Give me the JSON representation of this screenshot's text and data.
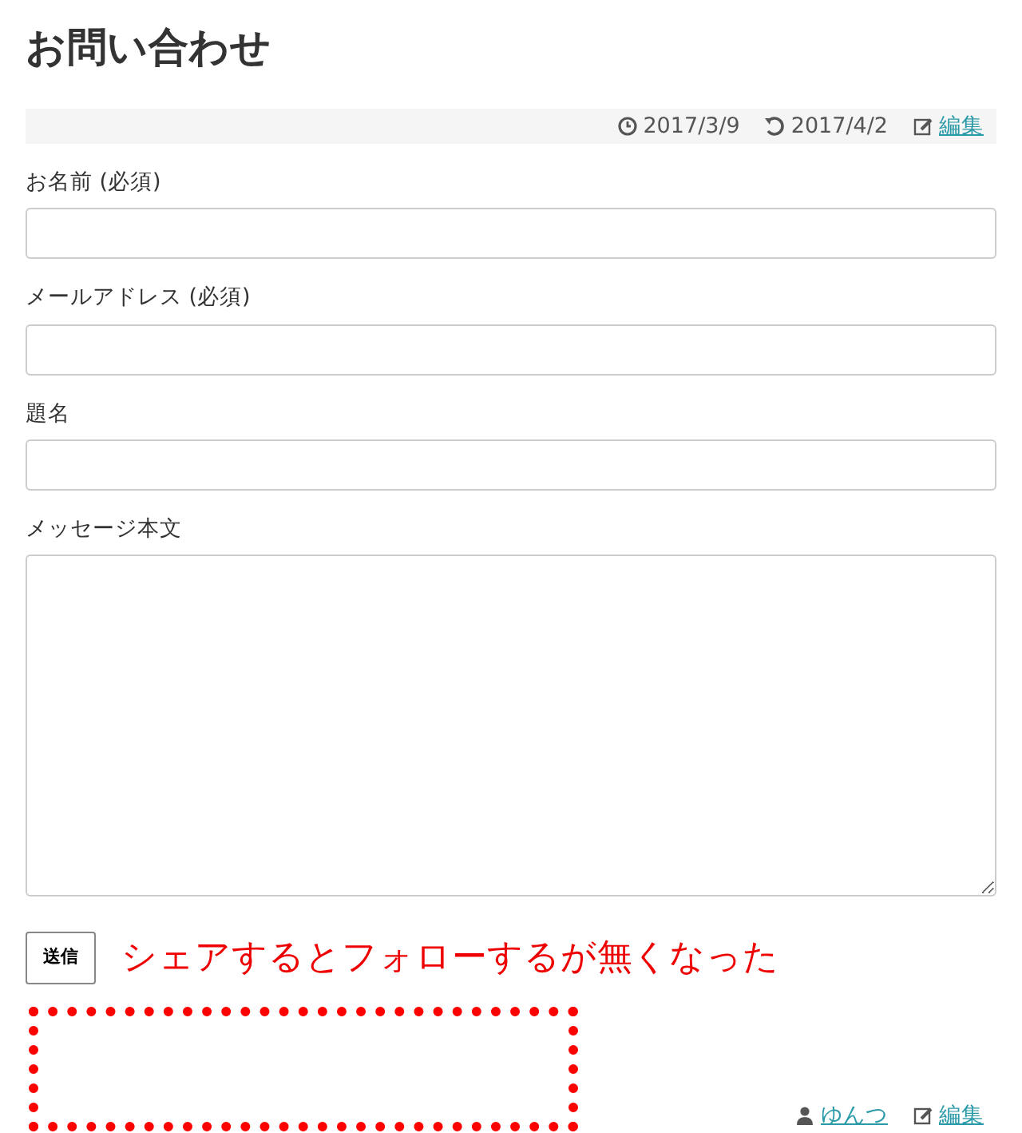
{
  "title": "お問い合わせ",
  "meta": {
    "published": "2017/3/9",
    "updated": "2017/4/2",
    "edit_link": "編集"
  },
  "fields": [
    {
      "label": "お名前 (必須)",
      "kind": "input"
    },
    {
      "label": "メールアドレス (必須)",
      "kind": "input"
    },
    {
      "label": "題名",
      "kind": "input"
    },
    {
      "label": "メッセージ本文",
      "kind": "textarea"
    }
  ],
  "submit_button": "送信",
  "annotation": "シェアするとフォローするが無くなった",
  "footer": {
    "author_link": "ゆんつ",
    "edit_link": "編集"
  }
}
